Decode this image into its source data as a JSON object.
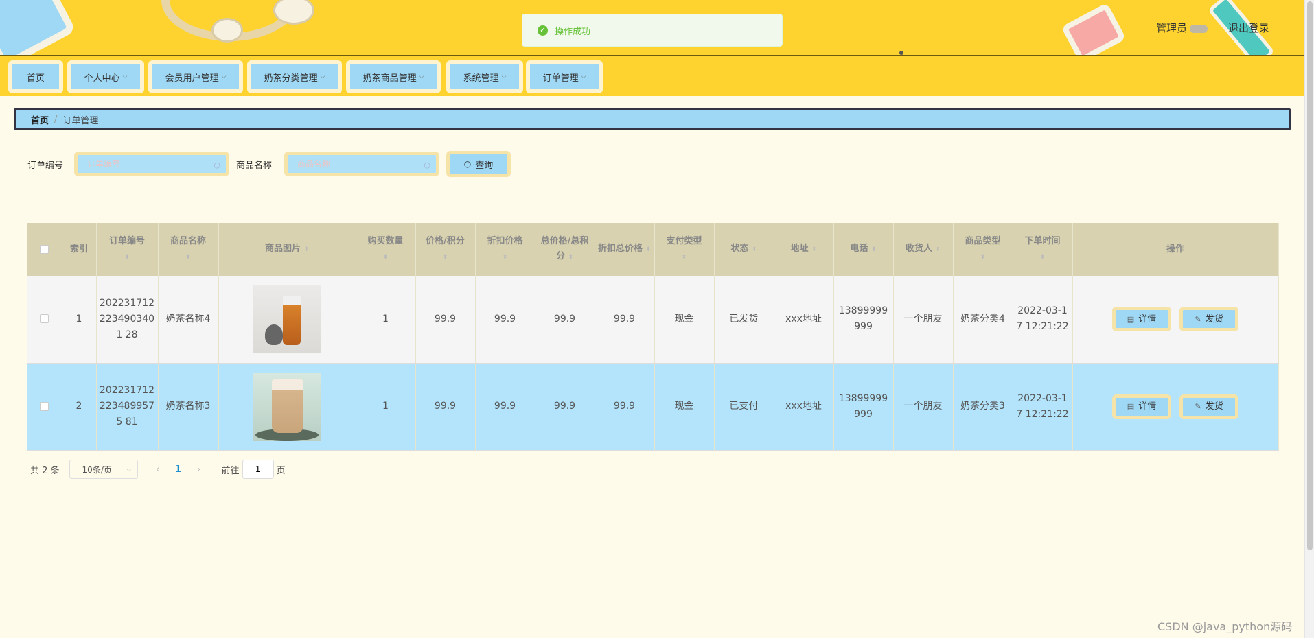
{
  "header": {
    "user_label": "管理员",
    "logout": "退出登录"
  },
  "toast": {
    "message": "操作成功"
  },
  "nav": [
    {
      "label": "首页",
      "dropdown": false
    },
    {
      "label": "个人中心",
      "dropdown": true
    },
    {
      "label": "会员用户管理",
      "dropdown": true
    },
    {
      "label": "奶茶分类管理",
      "dropdown": true
    },
    {
      "label": "奶茶商品管理",
      "dropdown": true
    },
    {
      "label": "系统管理",
      "dropdown": true
    },
    {
      "label": "订单管理",
      "dropdown": true
    }
  ],
  "breadcrumb": {
    "home": "首页",
    "separator": "/",
    "current": "订单管理"
  },
  "search": {
    "order_label": "订单编号",
    "order_placeholder": "订单编号",
    "goods_label": "商品名称",
    "goods_placeholder": "商品名称",
    "query_button": "查询"
  },
  "table": {
    "columns": [
      "索引",
      "订单编号",
      "商品名称",
      "商品图片",
      "购买数量",
      "价格/积分",
      "折扣价格",
      "总价格/总积分",
      "折扣总价格",
      "支付类型",
      "状态",
      "地址",
      "电话",
      "收货人",
      "商品类型",
      "下单时间",
      "操作"
    ],
    "rows": [
      {
        "index": "1",
        "order_no": "2022317122234903401 28",
        "goods": "奶茶名称4",
        "qty": "1",
        "price": "99.9",
        "discount": "99.9",
        "total": "99.9",
        "discount_total": "99.9",
        "pay": "现金",
        "status": "已发货",
        "address": "xxx地址",
        "phone": "13899999999",
        "receiver": "一个朋友",
        "type": "奶茶分类4",
        "time": "2022-03-17 12:21:22",
        "image": "tea-cup-icon"
      },
      {
        "index": "2",
        "order_no": "2022317122234899575 81",
        "goods": "奶茶名称3",
        "qty": "1",
        "price": "99.9",
        "discount": "99.9",
        "total": "99.9",
        "discount_total": "99.9",
        "pay": "现金",
        "status": "已支付",
        "address": "xxx地址",
        "phone": "13899999999",
        "receiver": "一个朋友",
        "type": "奶茶分类3",
        "time": "2022-03-17 12:21:22",
        "image": "milk-tea-cup-icon"
      }
    ],
    "detail_button": "详情",
    "ship_button": "发货"
  },
  "pager": {
    "total": "共 2 条",
    "page_size": "10条/页",
    "current_page": "1",
    "goto": "前往",
    "goto_value": "1",
    "page_unit": "页"
  },
  "watermark": "CSDN @java_python源码"
}
